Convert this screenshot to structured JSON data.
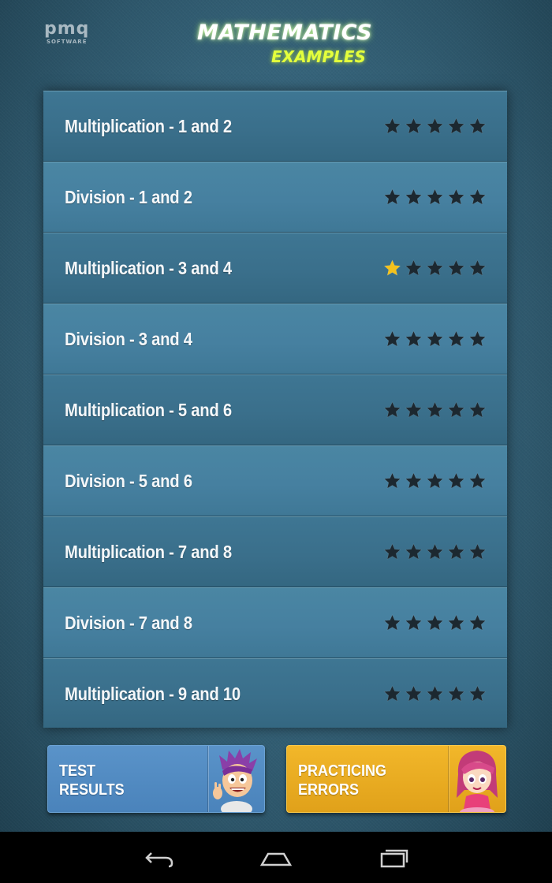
{
  "header": {
    "logo_main": "pmq",
    "logo_sub": "SOFTWARE",
    "title": "MATHEMATICS",
    "subtitle": "EXAMPLES"
  },
  "lessons": [
    {
      "label": "Multiplication - 1 and 2",
      "stars_earned": 0,
      "stars_total": 5
    },
    {
      "label": "Division - 1 and 2",
      "stars_earned": 0,
      "stars_total": 5
    },
    {
      "label": "Multiplication - 3 and 4",
      "stars_earned": 1,
      "stars_total": 5
    },
    {
      "label": "Division - 3 and 4",
      "stars_earned": 0,
      "stars_total": 5
    },
    {
      "label": "Multiplication - 5 and 6",
      "stars_earned": 0,
      "stars_total": 5
    },
    {
      "label": "Division - 5 and 6",
      "stars_earned": 0,
      "stars_total": 5
    },
    {
      "label": "Multiplication - 7 and 8",
      "stars_earned": 0,
      "stars_total": 5
    },
    {
      "label": "Division - 7 and 8",
      "stars_earned": 0,
      "stars_total": 5
    },
    {
      "label": "Multiplication - 9 and 10",
      "stars_earned": 0,
      "stars_total": 5
    }
  ],
  "buttons": {
    "test_results": {
      "line1": "TEST",
      "line2": "RESULTS",
      "icon": "boy-avatar-icon"
    },
    "practicing_errors": {
      "line1": "PRACTICING",
      "line2": "ERRORS",
      "icon": "girl-avatar-icon"
    }
  },
  "navbar": {
    "back_icon": "back-icon",
    "home_icon": "home-icon",
    "recent_icon": "recent-apps-icon"
  },
  "colors": {
    "star_earned": "#f4c21c",
    "star_empty": "#1c2830",
    "title_accent": "#e4ff3c",
    "test_button": "#5a93c9",
    "errors_button": "#f2b72a"
  }
}
